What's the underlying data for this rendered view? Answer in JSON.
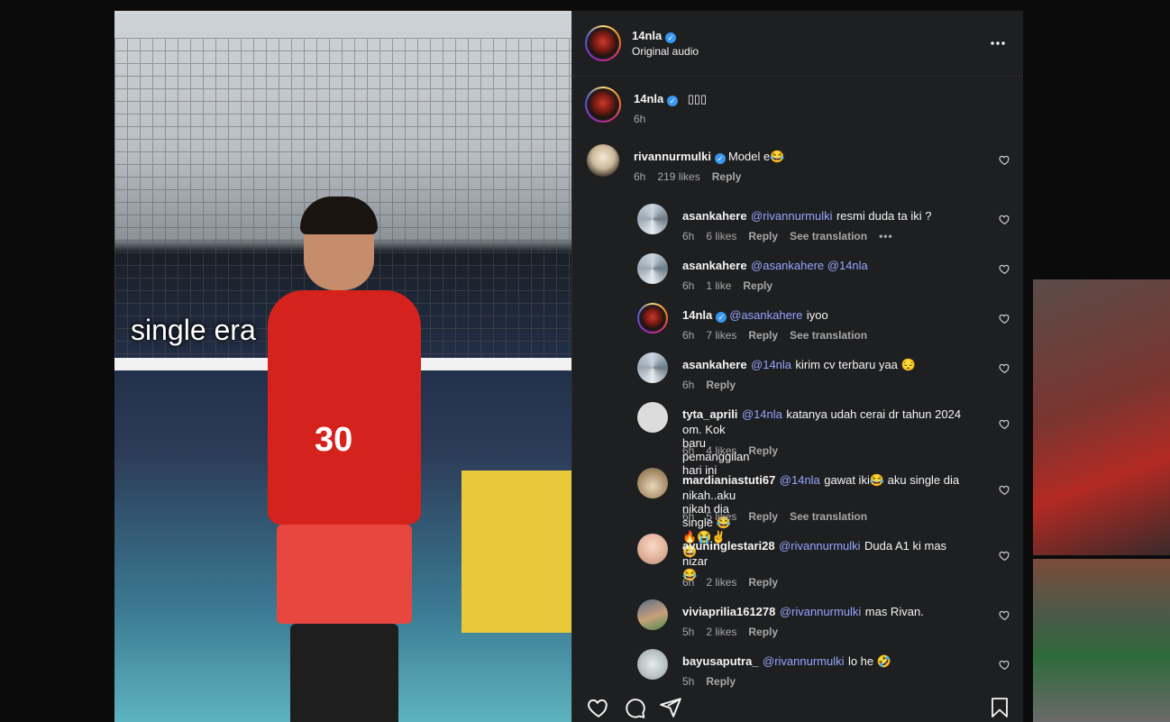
{
  "post": {
    "header": {
      "username": "14nla",
      "audio": "Original audio",
      "more_icon": "more-horizontal-icon"
    },
    "caption": {
      "username": "14nla",
      "text": "▯▯▯",
      "time": "6h"
    },
    "media_overlay_text": "single era",
    "jersey_number": "30"
  },
  "comments": [
    {
      "username": "rivannurmulki",
      "verified": true,
      "mention": "",
      "text": "Model e😂",
      "time": "6h",
      "likes": "219 likes",
      "reply": "Reply",
      "translate": ""
    },
    {
      "username": "asankahere",
      "verified": false,
      "mention": "@rivannurmulki",
      "text": "resmi duda ta iki ?",
      "time": "6h",
      "likes": "6 likes",
      "reply": "Reply",
      "translate": "See translation"
    },
    {
      "username": "asankahere",
      "verified": false,
      "mention": "@asankahere @14nla",
      "text": "",
      "time": "6h",
      "likes": "1 like",
      "reply": "Reply",
      "translate": ""
    },
    {
      "username": "14nla",
      "verified": true,
      "mention": "@asankahere",
      "text": "iyoo",
      "time": "6h",
      "likes": "7 likes",
      "reply": "Reply",
      "translate": "See translation"
    },
    {
      "username": "asankahere",
      "verified": false,
      "mention": "@14nla",
      "text": "kirim cv terbaru yaa 😔",
      "time": "6h",
      "likes": "",
      "reply": "Reply",
      "translate": ""
    },
    {
      "username": "tyta_aprili",
      "verified": false,
      "mention": "@14nla",
      "text": "katanya udah cerai dr tahun 2024",
      "text2": "om. Kok baru pemanggilan hari ini",
      "time": "6h",
      "likes": "4 likes",
      "reply": "Reply",
      "translate": ""
    },
    {
      "username": "mardianiastuti67",
      "verified": false,
      "mention": "@14nla",
      "text": "gawat iki😂  aku single dia",
      "text2": "nikah..aku nikah dia single 😂🔥😭✌️😆",
      "time": "6h",
      "likes": "5 likes",
      "reply": "Reply",
      "translate": "See translation"
    },
    {
      "username": "ayuninglestari28",
      "verified": false,
      "mention": "@rivannurmulki",
      "text": "Duda A1 ki mas",
      "text2": "nizar 😂",
      "time": "6h",
      "likes": "2 likes",
      "reply": "Reply",
      "translate": ""
    },
    {
      "username": "viviaprilia161278",
      "verified": false,
      "mention": "@rivannurmulki",
      "text": "mas Rivan.",
      "time": "5h",
      "likes": "2 likes",
      "reply": "Reply",
      "translate": ""
    },
    {
      "username": "bayusaputra_",
      "verified": false,
      "mention": "@rivannurmulki",
      "text": "lo he 🤣",
      "time": "5h",
      "likes": "",
      "reply": "Reply",
      "translate": ""
    }
  ],
  "more_options": "•••",
  "action_bar": {
    "icons": [
      "heart-icon",
      "comment-icon",
      "share-icon",
      "bookmark-icon"
    ]
  }
}
